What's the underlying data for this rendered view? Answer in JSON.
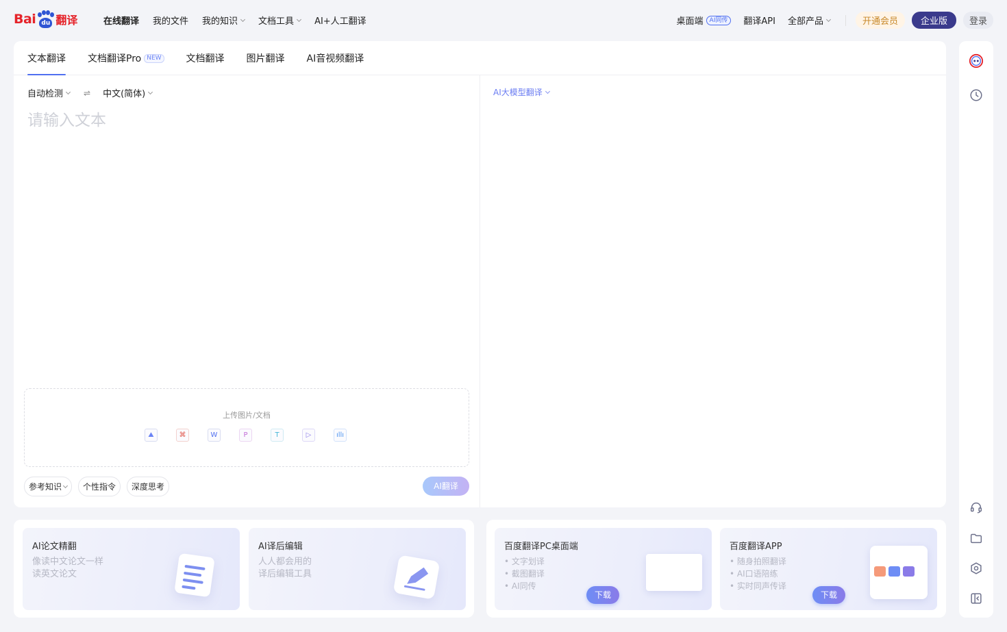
{
  "logo": {
    "bai": "Bai",
    "du": "du",
    "fanyi": "翻译"
  },
  "nav_left": [
    {
      "label": "在线翻译",
      "active": true,
      "dropdown": false
    },
    {
      "label": "我的文件",
      "active": false,
      "dropdown": false
    },
    {
      "label": "我的知识",
      "active": false,
      "dropdown": true
    },
    {
      "label": "文档工具",
      "active": false,
      "dropdown": true
    },
    {
      "label": "AI+人工翻译",
      "active": false,
      "dropdown": false
    }
  ],
  "nav_right": {
    "desktop": "桌面端",
    "desktop_badge": "AI同传",
    "api": "翻译API",
    "all_products": "全部产品",
    "vip": "开通会员",
    "enterprise": "企业版",
    "login": "登录"
  },
  "tabs": [
    {
      "label": "文本翻译",
      "active": true,
      "badge": ""
    },
    {
      "label": "文档翻译Pro",
      "active": false,
      "badge": "NEW"
    },
    {
      "label": "文档翻译",
      "active": false,
      "badge": ""
    },
    {
      "label": "图片翻译",
      "active": false,
      "badge": ""
    },
    {
      "label": "AI音视频翻译",
      "active": false,
      "badge": ""
    }
  ],
  "source": {
    "from_lang": "自动检测",
    "to_lang": "中文(简体)",
    "swap_icon": "⇌",
    "placeholder": "请输入文本"
  },
  "target": {
    "model_label": "AI大模型翻译"
  },
  "upload": {
    "label": "上传图片/文档",
    "icons": [
      {
        "name": "image-file-icon",
        "glyph": "⛰",
        "cls": "img"
      },
      {
        "name": "pdf-file-icon",
        "glyph": "⌘",
        "cls": "pdf"
      },
      {
        "name": "word-file-icon",
        "glyph": "W",
        "cls": "word"
      },
      {
        "name": "ppt-file-icon",
        "glyph": "P",
        "cls": "ppt"
      },
      {
        "name": "txt-file-icon",
        "glyph": "T",
        "cls": "txt"
      },
      {
        "name": "video-file-icon",
        "glyph": "▷",
        "cls": "vid"
      },
      {
        "name": "audio-file-icon",
        "glyph": "ıllı",
        "cls": "aud"
      }
    ]
  },
  "chips": {
    "knowledge": "参考知识",
    "instruction": "个性指令",
    "deep_think": "深度思考"
  },
  "translate_button": "AI翻译",
  "promos": {
    "paper": {
      "title": "AI论文精翻",
      "line1": "像读中文论文一样",
      "line2": "读英文论文"
    },
    "post_edit": {
      "title": "AI译后编辑",
      "line1": "人人都会用的",
      "line2": "译后编辑工具"
    },
    "pc": {
      "title": "百度翻译PC桌面端",
      "bullets": [
        "文字划译",
        "截图翻译",
        "AI同传"
      ],
      "download": "下载"
    },
    "app": {
      "title": "百度翻译APP",
      "bullets": [
        "随身拍照翻译",
        "AI口语陪练",
        "实时同声传译"
      ],
      "download": "下载"
    }
  },
  "colors": {
    "accent": "#4f6ff0",
    "brand_red": "#e5232a",
    "enterprise": "#3a3a8c"
  }
}
